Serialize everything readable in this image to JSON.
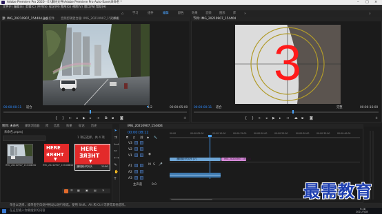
{
  "title_bar": {
    "title": "Adobe Premiere Pro 2020 - E:\\素材文件\\Adobe Premiere Pro Auto-Save\\未命名 *"
  },
  "menu": [
    "文件(F)",
    "编辑(E)",
    "剪辑(C)",
    "序列(S)",
    "标记(M)",
    "图形(G)",
    "视图(V)",
    "窗口(W)",
    "帮助(H)"
  ],
  "workspaces": [
    {
      "label": "学习",
      "active": false
    },
    {
      "label": "组件",
      "active": false
    },
    {
      "label": "编辑",
      "active": true
    },
    {
      "label": "颜色",
      "active": false
    },
    {
      "label": "效果",
      "active": false
    },
    {
      "label": "音频",
      "active": false
    },
    {
      "label": "图形",
      "active": false
    },
    {
      "label": "库",
      "active": false
    }
  ],
  "source_monitor": {
    "tabs": [
      "源: IMG_20210907_154404.jpg",
      "效果控件",
      "音频剪辑混合器: IMG_20210907_154404",
      "元数据"
    ],
    "timecode_left": "00:00:00:11",
    "fit": "适合",
    "scale": "1/2",
    "timecode_right": "00:00:05:00"
  },
  "program_monitor": {
    "tab": "节目: IMG_20210907_154404",
    "timecode_left": "00:00:00:11",
    "fit": "适合",
    "scale": "完整",
    "timecode_right": "00:00:16:00",
    "countdown_number": "3"
  },
  "project_panel": {
    "tabs": [
      "项目: 未命名",
      "媒体浏览器",
      "库",
      "信息",
      "效果",
      "标记",
      "历史"
    ],
    "project_file": "未命名.prproj",
    "item_count": "1 项已选择，共 4 项",
    "items": [
      {
        "name": "IMG_20210907_154404",
        "duration": "5:00"
      },
      {
        "name": "IMG_20210907_154404",
        "duration": "5:00"
      },
      {
        "name": "通用倒计时片头",
        "duration": "11:00"
      }
    ],
    "thumb_text": [
      "HERE",
      "THERE"
    ]
  },
  "timeline": {
    "tab": "IMG_20210907_154404",
    "timecode": "00:00:08:12",
    "ruler": [
      "00:00",
      "00:00:05:00",
      "00:00:10:00",
      "00:00:15:00",
      "00:00:20:00",
      "00:00:25:00",
      "00:00:30:00",
      "00:00:35:00",
      "00:00:40:00"
    ],
    "tracks": [
      {
        "label": "V3"
      },
      {
        "label": "V2"
      },
      {
        "label": "V1"
      },
      {
        "label": "A1"
      },
      {
        "label": "A2"
      },
      {
        "label": "A3"
      }
    ],
    "master": {
      "label": "主声道",
      "value": "0.0"
    },
    "clips": [
      {
        "name": "通用倒计时片头 [V]",
        "track": "V1",
        "color": "#6ea6d6"
      },
      {
        "name": "IMG_20210907_154404",
        "track": "V1",
        "color": "#d68ad8"
      },
      {
        "name": "",
        "track": "A1",
        "color": "#3f7ab0"
      }
    ]
  },
  "status_bar": {
    "text": "单击以选择，或单击空白处并拖动以进行框选。使用 Shift、Alt 和 Ctrl 可获得其他选项。"
  },
  "watermark": {
    "text": "最需教育"
  },
  "taskbar": {
    "time": "9:28",
    "date": "2021/7/28",
    "search": "在这里输入你要搜索的内容"
  },
  "colors": {
    "accent": "#2e8bff",
    "countdown_red": "#ff1a1a",
    "countdown_ring": "#b19b2a",
    "watermark_blue": "#1e3fb0"
  }
}
